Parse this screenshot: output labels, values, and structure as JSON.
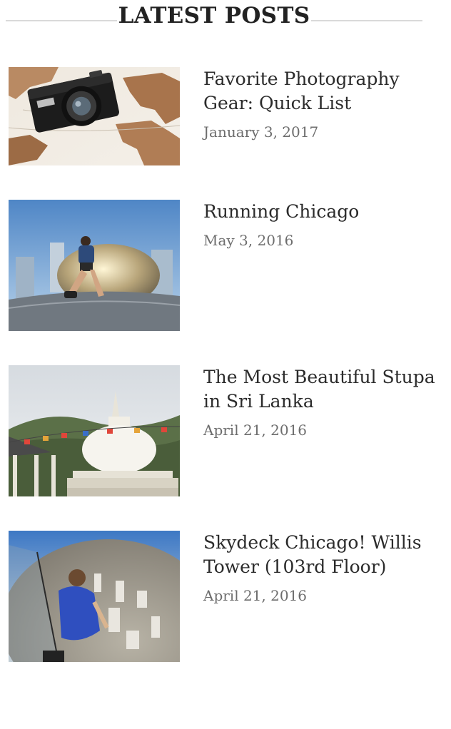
{
  "header": {
    "title": "LATEST POSTS"
  },
  "posts": [
    {
      "title": "Favorite Photography Gear: Quick List",
      "date": "January 3, 2017",
      "thumbnail": "camera-on-map"
    },
    {
      "title": "Running Chicago",
      "date": "May 3, 2016",
      "thumbnail": "runner-at-bean"
    },
    {
      "title": "The Most Beautiful Stupa in Sri Lanka",
      "date": "April 21, 2016",
      "thumbnail": "white-stupa"
    },
    {
      "title": "Skydeck Chicago! Willis Tower (103rd Floor)",
      "date": "April 21, 2016",
      "thumbnail": "skydeck-view"
    }
  ],
  "colors": {
    "title": "#2b2b2b",
    "date": "#6d6d6d",
    "rule": "#d9d9d9"
  }
}
